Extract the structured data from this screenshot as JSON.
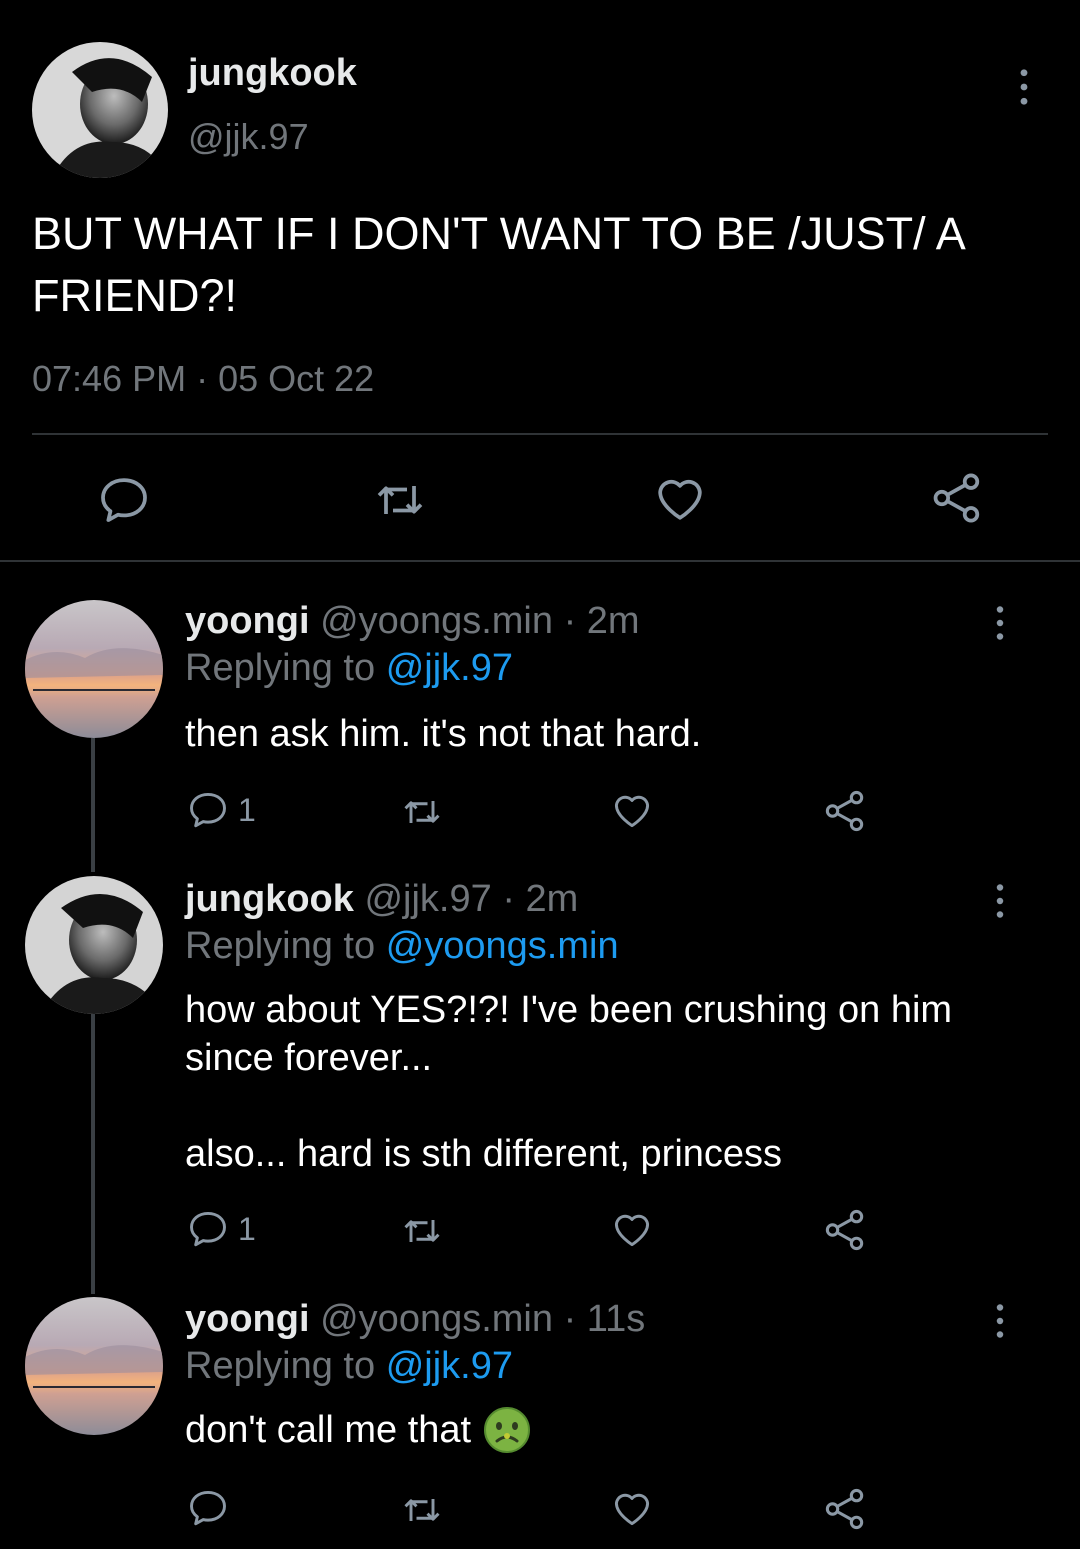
{
  "main": {
    "name": "jungkook",
    "handle": "@jjk.97",
    "text": "BUT WHAT IF I DON'T WANT TO BE /JUST/ A FRIEND?!",
    "timestamp": "07:46 PM · 05 Oct 22",
    "icons": [
      "reply-icon",
      "retweet-icon",
      "like-icon",
      "share-icon",
      "more-icon"
    ]
  },
  "replies": [
    {
      "name": "yoongi",
      "handle": "@yoongs.min",
      "time": "· 2m",
      "replying_label": "Replying to",
      "replying_to": "@jjk.97",
      "text_lines": [
        "then ask him. it's not that hard."
      ],
      "reply_count": "1"
    },
    {
      "name": "jungkook",
      "handle": "@jjk.97",
      "time": "· 2m",
      "replying_label": "Replying to",
      "replying_to": "@yoongs.min",
      "text_lines": [
        "how about YES?!?! I've been crushing on him",
        "since forever...",
        "also... hard is sth different, princess"
      ],
      "reply_count": "1"
    },
    {
      "name": "yoongi",
      "handle": "@yoongs.min",
      "time": "· 11s",
      "replying_label": "Replying to",
      "replying_to": "@jjk.97",
      "text_lines": [
        "don't call me that"
      ],
      "emoji": "nauseated-face",
      "reply_count": ""
    }
  ],
  "colors": {
    "background": "#000000",
    "text": "#e7e9ea",
    "muted": "#71767b",
    "link": "#1d9bf0",
    "divider": "#2f3336"
  }
}
